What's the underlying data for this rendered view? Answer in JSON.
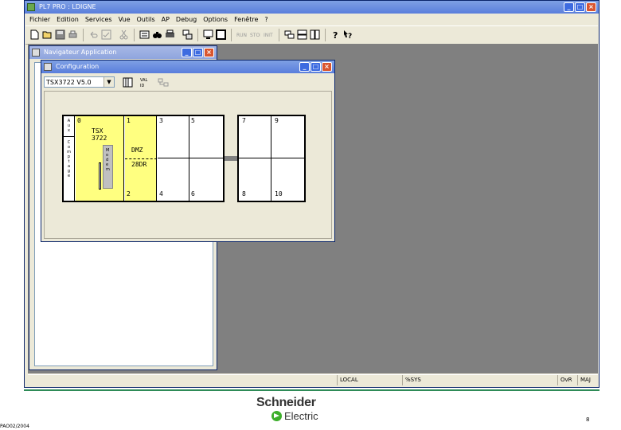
{
  "app_window": {
    "title": "PL7 PRO : LDIGNE",
    "menu": [
      "Fichier",
      "Edition",
      "Services",
      "Vue",
      "Outils",
      "AP",
      "Debug",
      "Options",
      "Fenêtre",
      "?"
    ],
    "toolbar_icons": [
      "new-icon",
      "open-icon",
      "save-icon",
      "print-icon",
      "undo-icon",
      "check-icon",
      "cut-icon",
      "list-icon",
      "binoculars-icon",
      "printer-icon",
      "transfer-icon",
      "screen-icon",
      "frame-icon",
      "run-icon",
      "stop-icon",
      "init-icon",
      "window-a-icon",
      "window-b-icon",
      "window-c-icon",
      "help-icon",
      "help-context-icon"
    ]
  },
  "navigator": {
    "title": "Navigateur Application"
  },
  "config": {
    "title": "Configuration",
    "processor_select": "TSX3722 V5.0",
    "rack1": {
      "power_label_top": "A\nu\nx",
      "power_label_bottom": "C\no\nm\np\nt\na\ng\ne",
      "cpu_number": "0",
      "cpu_name": "TSX\n3722",
      "cpu_module_text": "M\no\nd\ne\nm",
      "slot1": "1",
      "slot2": "2",
      "module_name": "DMZ",
      "module_ref": "28DR",
      "slot3": "3",
      "slot4": "4",
      "slot5": "5",
      "slot6": "6"
    },
    "rack2": {
      "slot7": "7",
      "slot8": "8",
      "slot9": "9",
      "slot10": "10"
    }
  },
  "statusbar": {
    "mode": "LOCAL",
    "sys": "%SYS",
    "ovr": "OvR",
    "maj": "MAJ"
  },
  "footer": {
    "brand_line1": "Schneider",
    "brand_line2": "Electric",
    "page_number": "8",
    "doc_ref": "PAO02/2004"
  },
  "colors": {
    "module_yellow": "#ffff80",
    "mdi_gray": "#808080",
    "footer_line": "#2e8b57"
  }
}
